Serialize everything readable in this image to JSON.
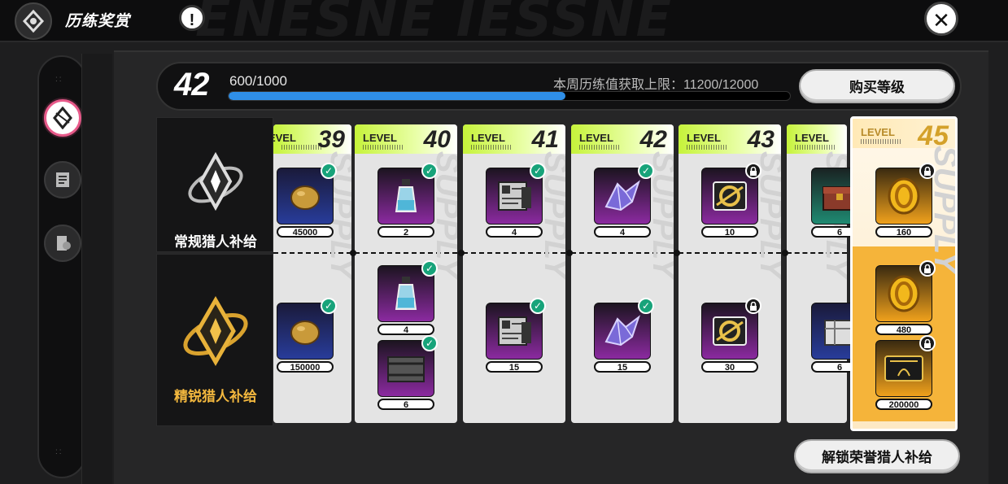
{
  "header": {
    "title": "历练奖赏",
    "info_icon": "exclamation-icon",
    "close_icon": "close-icon"
  },
  "sidebar": {
    "items": [
      {
        "icon": "pass-emblem-icon",
        "active": true
      },
      {
        "icon": "task-list-icon",
        "active": false
      },
      {
        "icon": "book-icon",
        "active": false
      }
    ]
  },
  "progress": {
    "level": "42",
    "xp_text": "600/1000",
    "xp_fraction": 0.6,
    "weekly_cap_text": "本周历练值获取上限：11200/12000"
  },
  "buttons": {
    "buy_level": "购买等级",
    "unlock_elite": "解锁荣誉猎人补给"
  },
  "rows": {
    "regular_label": "常规猎人补给",
    "elite_label": "精锐猎人补给"
  },
  "level_word": "LEVEL",
  "columns": [
    {
      "level": "39",
      "regular": [
        {
          "icon": "egg-icon",
          "color": "blue",
          "qty": "45000",
          "status": "claimed"
        }
      ],
      "elite": [
        {
          "icon": "egg-icon",
          "color": "blue",
          "qty": "150000",
          "status": "claimed"
        }
      ]
    },
    {
      "level": "40",
      "regular": [
        {
          "icon": "potion-bottle-icon",
          "color": "purple",
          "qty": "2",
          "status": "claimed"
        }
      ],
      "elite": [
        {
          "icon": "potion-bottle-icon",
          "color": "purple",
          "qty": "4",
          "status": "claimed"
        },
        {
          "icon": "metal-crate-icon",
          "color": "purple",
          "qty": "6",
          "status": "claimed"
        }
      ]
    },
    {
      "level": "41",
      "regular": [
        {
          "icon": "blueprint-card-icon",
          "color": "purple",
          "qty": "4",
          "status": "claimed"
        }
      ],
      "elite": [
        {
          "icon": "blueprint-card-icon",
          "color": "purple",
          "qty": "15",
          "status": "claimed"
        }
      ]
    },
    {
      "level": "42",
      "regular": [
        {
          "icon": "crystal-shard-icon",
          "color": "purple",
          "qty": "4",
          "status": "claimed"
        }
      ],
      "elite": [
        {
          "icon": "crystal-shard-icon",
          "color": "purple",
          "qty": "15",
          "status": "claimed"
        }
      ]
    },
    {
      "level": "43",
      "regular": [
        {
          "icon": "golden-ticket-icon",
          "color": "purple",
          "qty": "10",
          "status": "locked"
        }
      ],
      "elite": [
        {
          "icon": "golden-ticket-icon",
          "color": "purple",
          "qty": "30",
          "status": "locked"
        }
      ]
    },
    {
      "level": "",
      "regular": [
        {
          "icon": "treasure-chest-icon",
          "color": "teal",
          "qty": "6",
          "status": "none"
        }
      ],
      "elite": [
        {
          "icon": "silver-case-icon",
          "color": "blue",
          "qty": "6",
          "status": "none"
        }
      ]
    },
    {
      "level": "45",
      "special": true,
      "regular": [
        {
          "icon": "gold-coin-icon",
          "color": "gold",
          "qty": "160",
          "status": "locked"
        }
      ],
      "elite": [
        {
          "icon": "gold-coin-icon",
          "color": "gold",
          "qty": "480",
          "status": "locked"
        },
        {
          "icon": "gold-card-icon",
          "color": "gold",
          "qty": "200000",
          "status": "locked"
        }
      ]
    }
  ],
  "colors": {
    "accent_lime": "#c6f33a",
    "progress_blue": "#2f8fe8",
    "claimed_green": "#17a37a",
    "active_pink": "#e85a8a",
    "elite_gold": "#f0b43a"
  }
}
